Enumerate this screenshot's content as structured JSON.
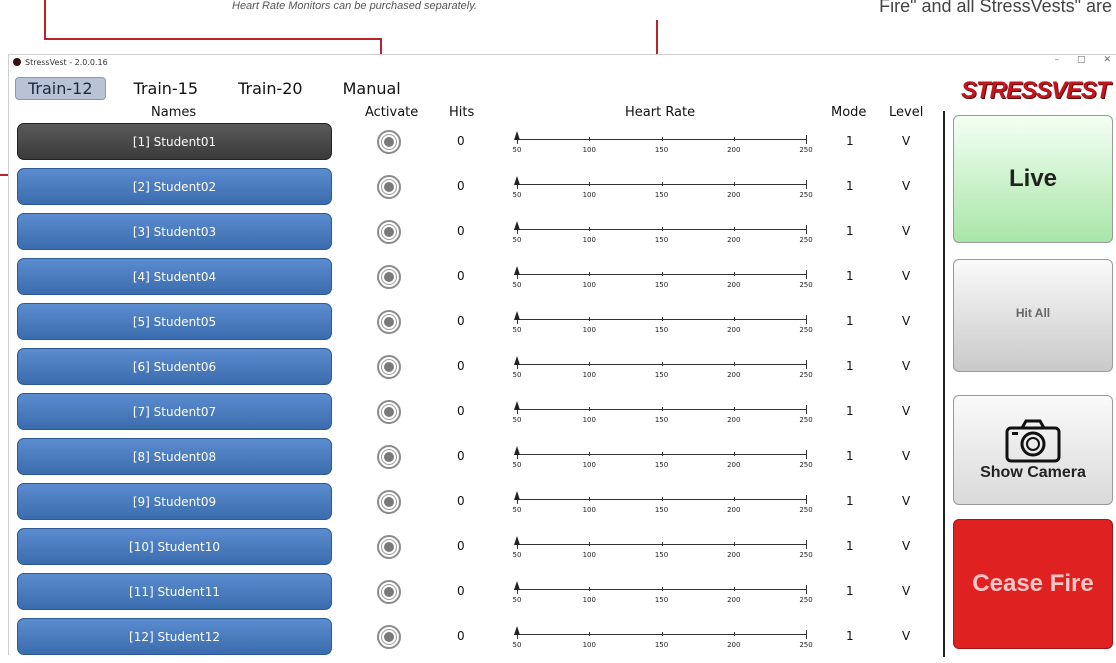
{
  "annotations": {
    "top_note": "Heart Rate Monitors can be purchased separately.",
    "right_note": "Fire\" and all StressVests\" are"
  },
  "window": {
    "title": "StressVest - 2.0.0.16",
    "controls": [
      "–",
      "□",
      "✕"
    ]
  },
  "tabs": [
    {
      "label": "Train-12",
      "active": true
    },
    {
      "label": "Train-15",
      "active": false
    },
    {
      "label": "Train-20",
      "active": false
    },
    {
      "label": "Manual",
      "active": false
    }
  ],
  "logo_text": "STRESSVEST",
  "headers": {
    "names": "Names",
    "activate": "Activate",
    "hits": "Hits",
    "heart_rate": "Heart Rate",
    "mode": "Mode",
    "level": "Level"
  },
  "heart_rate_ticks": [
    "50",
    "100",
    "150",
    "200",
    "250"
  ],
  "students": [
    {
      "name": "[1] Student01",
      "hits": "0",
      "mode": "1",
      "level": "V",
      "heart_rate": 50,
      "selected": true
    },
    {
      "name": "[2] Student02",
      "hits": "0",
      "mode": "1",
      "level": "V",
      "heart_rate": 50,
      "selected": false
    },
    {
      "name": "[3] Student03",
      "hits": "0",
      "mode": "1",
      "level": "V",
      "heart_rate": 50,
      "selected": false
    },
    {
      "name": "[4] Student04",
      "hits": "0",
      "mode": "1",
      "level": "V",
      "heart_rate": 50,
      "selected": false
    },
    {
      "name": "[5] Student05",
      "hits": "0",
      "mode": "1",
      "level": "V",
      "heart_rate": 50,
      "selected": false
    },
    {
      "name": "[6] Student06",
      "hits": "0",
      "mode": "1",
      "level": "V",
      "heart_rate": 50,
      "selected": false
    },
    {
      "name": "[7] Student07",
      "hits": "0",
      "mode": "1",
      "level": "V",
      "heart_rate": 50,
      "selected": false
    },
    {
      "name": "[8] Student08",
      "hits": "0",
      "mode": "1",
      "level": "V",
      "heart_rate": 50,
      "selected": false
    },
    {
      "name": "[9] Student09",
      "hits": "0",
      "mode": "1",
      "level": "V",
      "heart_rate": 50,
      "selected": false
    },
    {
      "name": "[10] Student10",
      "hits": "0",
      "mode": "1",
      "level": "V",
      "heart_rate": 50,
      "selected": false
    },
    {
      "name": "[11] Student11",
      "hits": "0",
      "mode": "1",
      "level": "V",
      "heart_rate": 50,
      "selected": false
    },
    {
      "name": "[12] Student12",
      "hits": "0",
      "mode": "1",
      "level": "V",
      "heart_rate": 50,
      "selected": false
    }
  ],
  "side_buttons": {
    "live": "Live",
    "hit_all": "Hit All",
    "show_camera": "Show Camera",
    "cease_fire": "Cease Fire"
  },
  "icons": {
    "app": "app-dot-icon",
    "activate": "target-ring-icon",
    "camera": "camera-icon"
  },
  "colors": {
    "student_button": "#4a7cc0",
    "selected_student": "#4a4a4a",
    "live": "#b8ecb8",
    "cease_fire": "#e02121",
    "logo": "#c4151c",
    "annotation_line": "#b8242b"
  }
}
